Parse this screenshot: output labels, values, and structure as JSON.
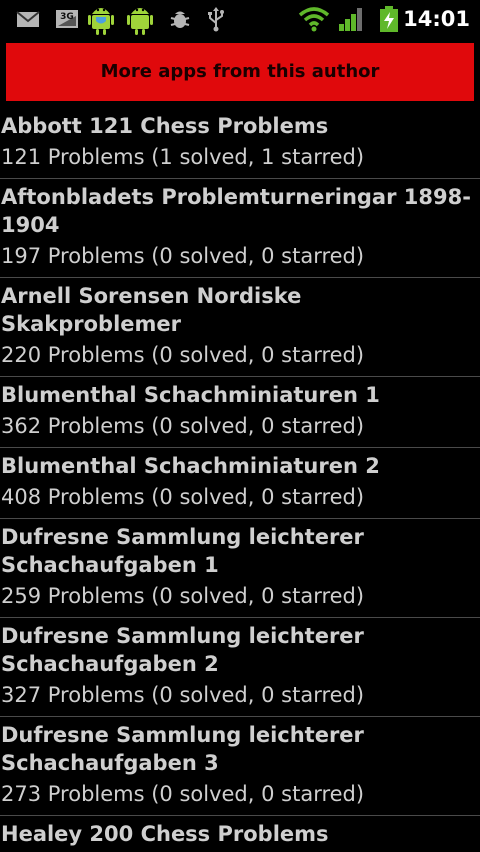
{
  "status_bar": {
    "time": "14:01",
    "network_label": "3G",
    "icons": [
      "gmail-icon",
      "3g-data-icon",
      "android-trophy-icon",
      "android-icon",
      "debug-icon",
      "usb-icon",
      "wifi-icon",
      "signal-icon",
      "battery-charging-icon"
    ]
  },
  "more_apps_label": "More apps from this author",
  "colors": {
    "accent": "#e0090c",
    "background": "#000000",
    "text": "#cfcfcf"
  },
  "items": [
    {
      "title": "Abbott 121 Chess Problems",
      "subtitle": "121 Problems (1 solved, 1 starred)"
    },
    {
      "title": "Aftonbladets Problemturneringar 1898-1904",
      "subtitle": "197 Problems (0 solved, 0 starred)"
    },
    {
      "title": "Arnell Sorensen Nordiske Skakproblemer",
      "subtitle": "220 Problems (0 solved, 0 starred)"
    },
    {
      "title": "Blumenthal Schachminiaturen 1",
      "subtitle": "362 Problems (0 solved, 0 starred)"
    },
    {
      "title": "Blumenthal Schachminiaturen 2",
      "subtitle": "408 Problems (0 solved, 0 starred)"
    },
    {
      "title": "Dufresne Sammlung leichterer Schachaufgaben 1",
      "subtitle": "259 Problems (0 solved, 0 starred)"
    },
    {
      "title": "Dufresne Sammlung leichterer Schachaufgaben 2",
      "subtitle": "327 Problems (0 solved, 0 starred)"
    },
    {
      "title": "Dufresne Sammlung leichterer Schachaufgaben 3",
      "subtitle": "273 Problems (0 solved, 0 starred)"
    },
    {
      "title": "Healey 200 Chess Problems",
      "subtitle": ""
    }
  ]
}
